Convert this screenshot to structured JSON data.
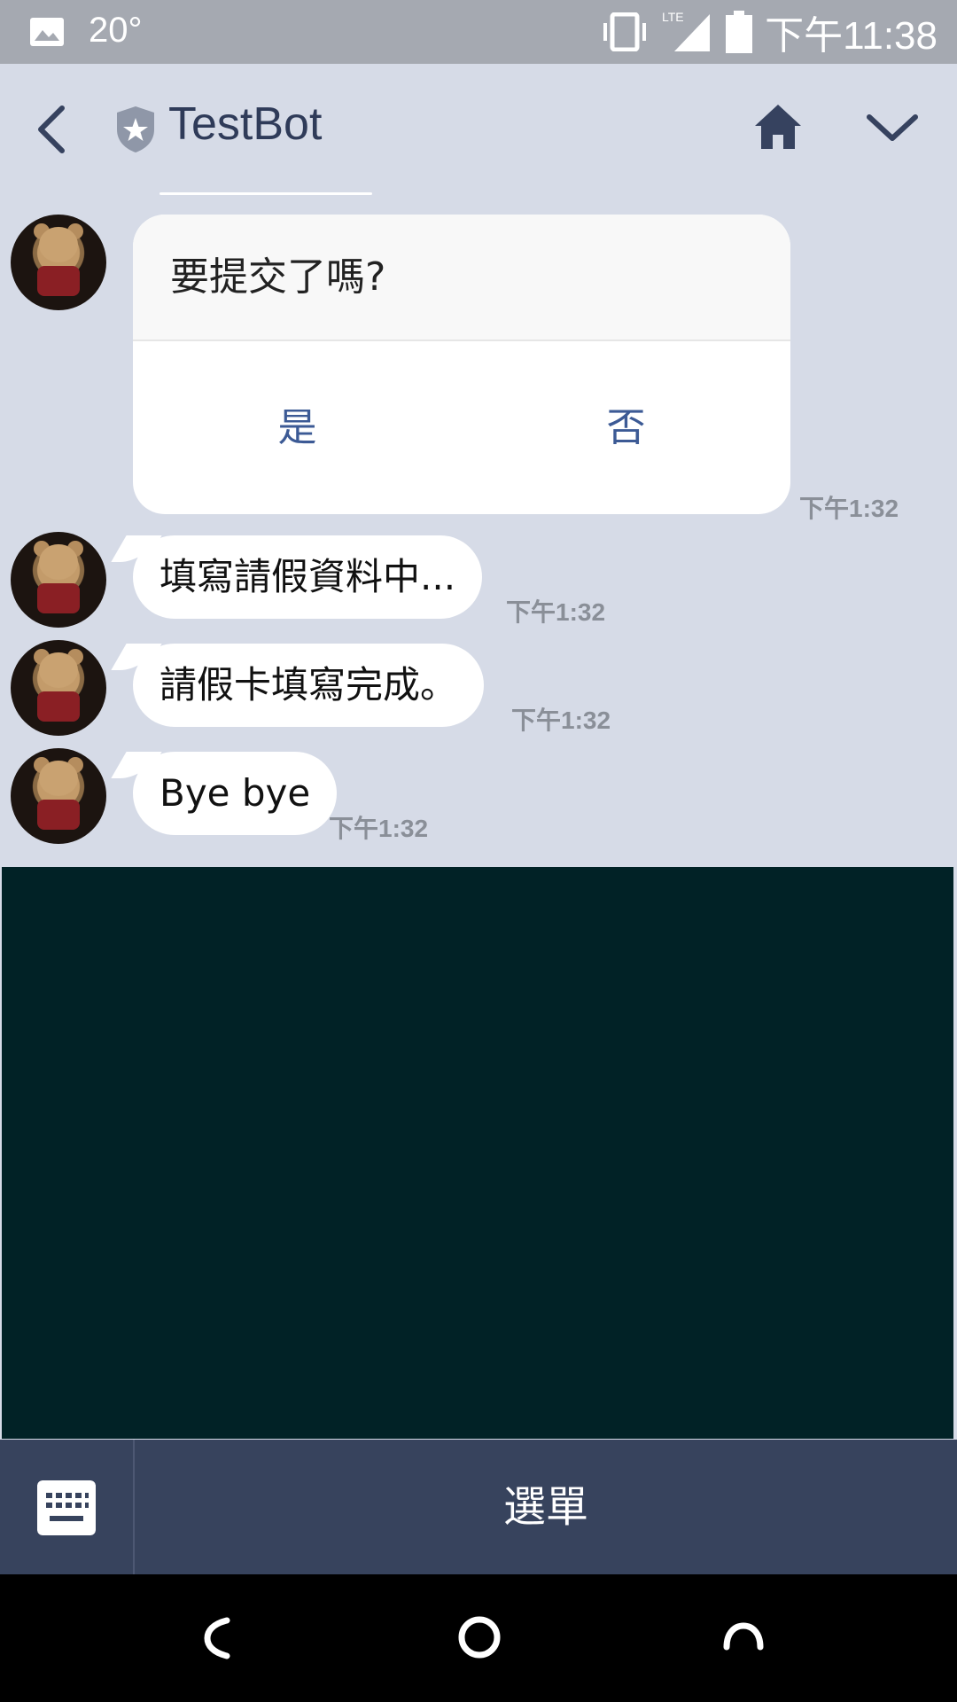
{
  "status_bar": {
    "temperature": "20°",
    "network": "LTE",
    "time": "下午11:38"
  },
  "header": {
    "title": "TestBot"
  },
  "chat": {
    "confirm_card": {
      "question": "要提交了嗎?",
      "yes_label": "是",
      "no_label": "否",
      "time": "下午1:32"
    },
    "messages": [
      {
        "text": "填寫請假資料中...",
        "time": "下午1:32"
      },
      {
        "text": "請假卡填寫完成。",
        "time": "下午1:32"
      },
      {
        "text": "Bye bye",
        "time": "下午1:32"
      }
    ]
  },
  "menu_bar": {
    "label": "選單"
  },
  "colors": {
    "chat_background": "#d6dbe7",
    "menu_bar": "#37435d",
    "accent_button_text": "#3c5a95",
    "dark_panel": "#012226"
  }
}
